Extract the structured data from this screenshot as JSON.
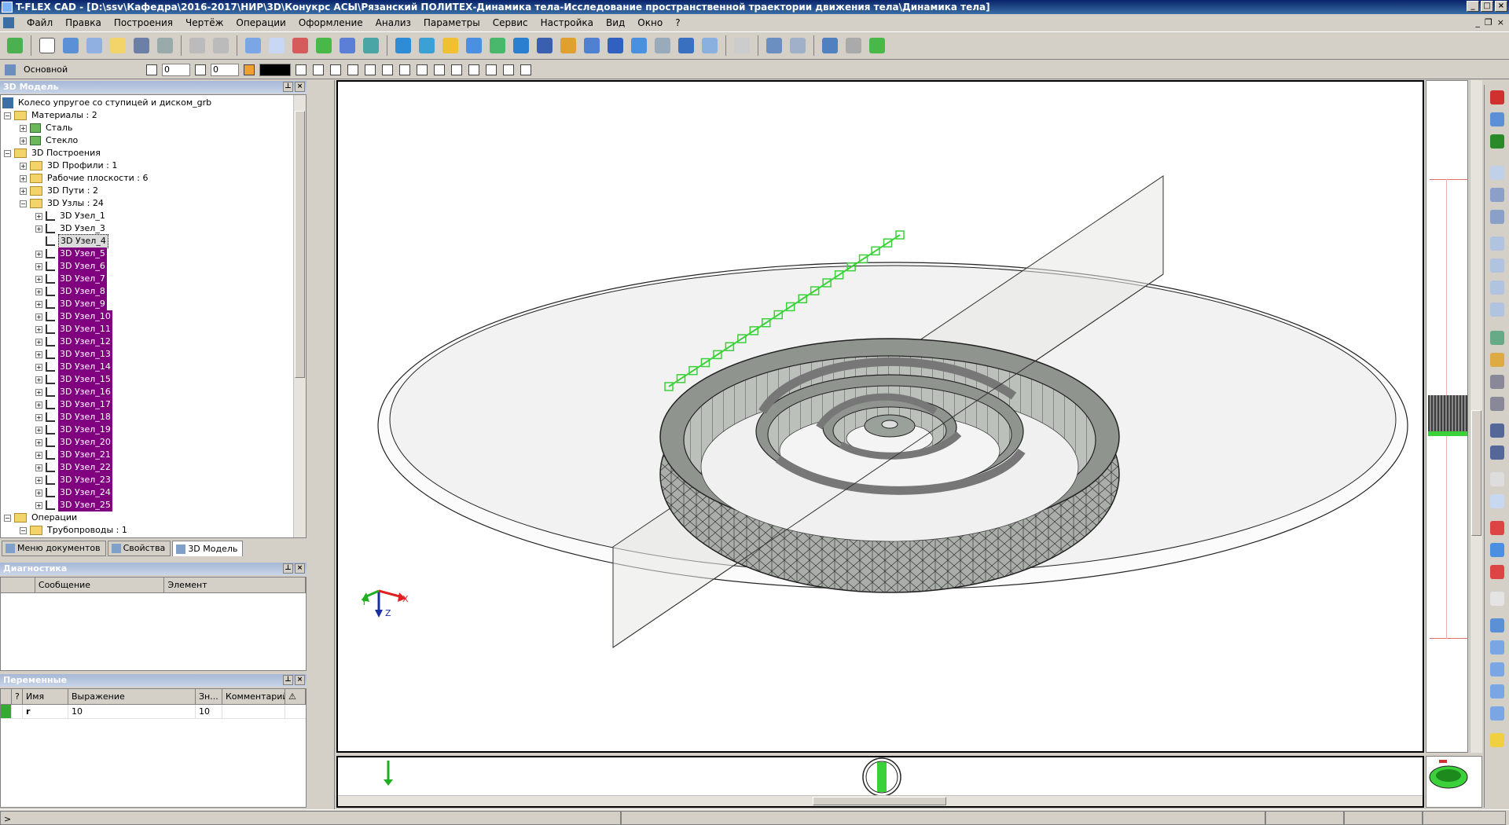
{
  "window": {
    "title": "T-FLEX CAD - [D:\\ssv\\Кафедра\\2016-2017\\НИР\\3D\\Конукрс АСЫ\\Рязанский ПОЛИТЕХ-Динамика тела-Исследование пространственной траектории движения тела\\Динамика тела]"
  },
  "menu": {
    "items": [
      "Файл",
      "Правка",
      "Построения",
      "Чертёж",
      "Операции",
      "Оформление",
      "Анализ",
      "Параметры",
      "Сервис",
      "Настройка",
      "Вид",
      "Окно",
      "?"
    ]
  },
  "toolbar2": {
    "layer_name": "Основной",
    "spin1_value": "0",
    "spin2_value": "0"
  },
  "model_panel": {
    "title": "3D Модель",
    "root": "Колесо упругое со ступицей и диском_grb",
    "materials": "Материалы : 2",
    "material_items": [
      "Сталь",
      "Стекло"
    ],
    "constructions": "3D Построения",
    "profiles": "3D Профили : 1",
    "planes": "Рабочие плоскости : 6",
    "paths": "3D Пути : 2",
    "nodes": "3D Узлы : 24",
    "node_items": [
      "3D Узел_1",
      "3D Узел_3",
      "3D Узел_4",
      "3D Узел_5",
      "3D Узел_6",
      "3D Узел_7",
      "3D Узел_8",
      "3D Узел_9",
      "3D Узел_10",
      "3D Узел_11",
      "3D Узел_12",
      "3D Узел_13",
      "3D Узел_14",
      "3D Узел_15",
      "3D Узел_16",
      "3D Узел_17",
      "3D Узел_18",
      "3D Узел_19",
      "3D Узел_20",
      "3D Узел_21",
      "3D Узел_22",
      "3D Узел_23",
      "3D Узел_24",
      "3D Узел_25"
    ],
    "operations": "Операции",
    "pipelines": "Трубопроводы : 1"
  },
  "tabs": [
    "Меню документов",
    "Свойства",
    "3D Модель"
  ],
  "diagnostics": {
    "title": "Диагностика",
    "columns": [
      "Сообщение",
      "Элемент"
    ]
  },
  "variables": {
    "title": "Переменные",
    "columns": [
      "?",
      "Имя",
      "Выражение",
      "Зн...",
      "Комментарий"
    ],
    "rows": [
      {
        "name": "r",
        "expression": "10",
        "value": "10",
        "comment": ""
      }
    ]
  },
  "viewport": {
    "axes": {
      "x": "X",
      "y": "Y",
      "z": "Z"
    }
  },
  "toolbar_icons": [
    "checkmark-icon",
    "new-icon",
    "open-icon",
    "save-icon",
    "print-icon",
    "undo-icon",
    "redo-icon",
    "sketch-icon",
    "workplane-icon",
    "node-icon",
    "profile-icon",
    "extrude-icon",
    "rotate-icon",
    "loft-icon",
    "sweep-icon",
    "boolean-icon",
    "fillet-icon",
    "chamfer-icon",
    "shell-icon",
    "pattern-icon",
    "measure-icon",
    "dimension-icon"
  ],
  "colors": {
    "selection": "#800080",
    "model_gray": "#9fa5a0",
    "path_green": "#3ad13a",
    "axis_x": "#e02020",
    "axis_y": "#1fae1f",
    "axis_z": "#1a2fa0"
  }
}
